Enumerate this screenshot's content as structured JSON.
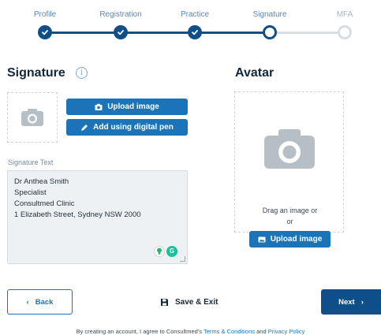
{
  "stepper": {
    "steps": [
      {
        "label": "Profile",
        "state": "done"
      },
      {
        "label": "Registration",
        "state": "done"
      },
      {
        "label": "Practice",
        "state": "done"
      },
      {
        "label": "Signature",
        "state": "current"
      },
      {
        "label": "MFA",
        "state": "todo"
      }
    ]
  },
  "signature": {
    "title": "Signature",
    "info_icon": "info-icon",
    "upload_label": "Upload image",
    "pen_label": "Add using digital pen",
    "text_label": "Signature Text",
    "text_lines": [
      "Dr Anthea Smith",
      "Specialist",
      "Consultmed Clinic",
      "1 Elizabeth Street, Sydney NSW 2000"
    ],
    "grammarly_icon_text": "G"
  },
  "avatar": {
    "title": "Avatar",
    "drag_text": "Drag an image or",
    "or_text": "or",
    "upload_label": "Upload image"
  },
  "footer": {
    "back_label": "Back",
    "save_label": "Save & Exit",
    "next_label": "Next",
    "terms_prefix": "By creating an account, I agree to Consultmed's ",
    "terms_link": "Terms & Conditions",
    "terms_and": " and ",
    "privacy_link": "Privacy Policy"
  },
  "colors": {
    "primary": "#0e4f8a",
    "accent": "#1c74b8",
    "inactive": "#d9dde1"
  }
}
